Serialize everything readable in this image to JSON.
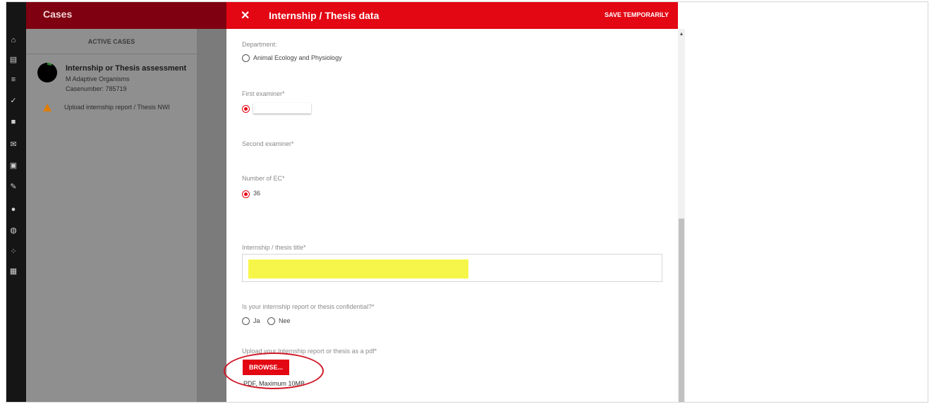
{
  "sidebar": {
    "icons": [
      "home-icon",
      "calendar-icon",
      "list-icon",
      "chart-icon",
      "briefcase-icon",
      "mail-icon",
      "archive-icon",
      "edit-icon",
      "person-icon",
      "globe-icon",
      "people-icon",
      "card-icon"
    ]
  },
  "cases": {
    "title": "Cases",
    "tab": "ACTIVE CASES",
    "item": {
      "title": "Internship or Thesis assessment",
      "program": "M Adaptive Organisms",
      "case_number": "Casenumber: 785719",
      "upload_text": "Upload internship report / Thesis NWI"
    }
  },
  "panel": {
    "close_symbol": "✕",
    "title": "Internship / Thesis data",
    "save_label": "SAVE TEMPORARILY"
  },
  "form": {
    "department_label": "Department:",
    "department_option": "Animal Ecology and Physiology",
    "first_examiner_label": "First examiner*",
    "second_examiner_label": "Second examiner*",
    "ec_label": "Number of EC*",
    "ec_value": "36",
    "title_label": "Internship / thesis title*",
    "confidential_label": "Is your internship report or thesis confidential?*",
    "confidential_options": [
      "Ja",
      "Nee"
    ],
    "upload_label": "Upload your Internship report or thesis as a pdf*",
    "browse_label": "BROWSE...",
    "upload_hint": "PDF, Maximum 10MB"
  },
  "colors": {
    "brand_red": "#e30613",
    "highlight_yellow": "#f6f64a",
    "annotation_red": "#d11a2a"
  }
}
